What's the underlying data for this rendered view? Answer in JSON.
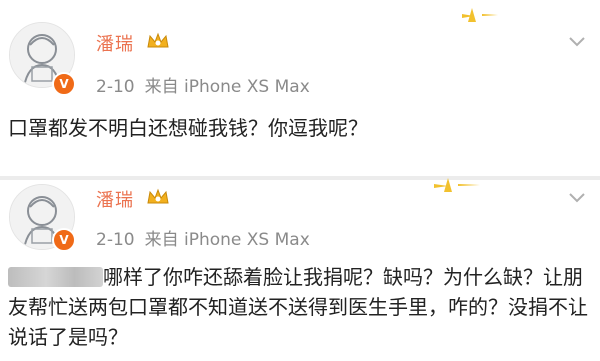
{
  "posts": [
    {
      "username": "潘瑞",
      "date": "2-10",
      "source": "来自 iPhone XS Max",
      "text": "口罩都发不明白还想碰我钱？你逗我呢？"
    },
    {
      "username": "潘瑞",
      "date": "2-10",
      "source": "来自 iPhone XS Max",
      "text": "哪样了你咋还舔着脸让我捐呢？缺吗？为什么缺？让朋友帮忙送两包口罩都不知道送不送得到医生手里，咋的？没捐不让说话了是吗？"
    }
  ],
  "icons": {
    "verified": "verified-v-icon",
    "crown": "crown-icon",
    "chevron": "chevron-down-icon"
  },
  "colors": {
    "username": "#eb7350",
    "meta": "#8a8a8a",
    "verified": "#f06a17",
    "crown": "#f2b01e"
  }
}
